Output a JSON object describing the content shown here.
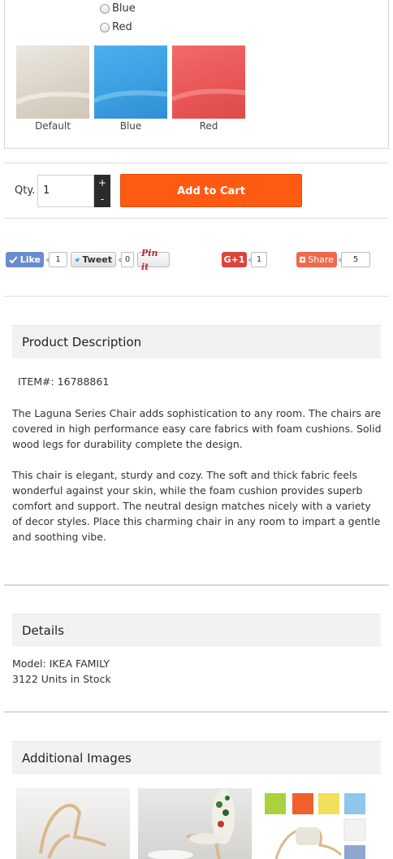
{
  "color_options": {
    "radios": [
      {
        "label": "Blue"
      },
      {
        "label": "Red"
      }
    ],
    "swatches": [
      {
        "label": "Default",
        "color": "#e3ddd3"
      },
      {
        "label": "Blue",
        "color": "#3aa0e0"
      },
      {
        "label": "Red",
        "color": "#ea5555"
      }
    ]
  },
  "cart": {
    "qty_label": "Qty.",
    "qty_value": "1",
    "plus": "+",
    "minus": "-",
    "add_label": "Add to Cart",
    "add_color": "#ff5a12"
  },
  "social": {
    "like": {
      "label": "Like",
      "count": "1",
      "icon": "check-icon",
      "color": "#6a8bd0"
    },
    "tweet": {
      "label": "Tweet",
      "count": "0",
      "icon": "twitter-bird-icon"
    },
    "pin": {
      "label": "Pin it",
      "icon": "pinterest-icon"
    },
    "gplus": {
      "label": "G+1",
      "count": "1",
      "color": "#d9453b"
    },
    "share": {
      "label": "Share",
      "count": "5",
      "icon": "plus-square-icon",
      "color": "#f0694e"
    }
  },
  "description": {
    "title": "Product Description",
    "item_number": "ITEM#: 16788861",
    "paragraph_1": "The Laguna Series Chair adds sophistication to any room. The chairs are covered in high performance easy care fabrics with foam cushions. Solid wood legs for durability complete the design.",
    "paragraph_2": "This chair is elegant, sturdy and cozy. The soft and thick fabric feels wonderful against your skin, while the foam cushion provides superb comfort and support. The neutral design matches nicely with a variety of decor styles. Place this charming chair in any room to impart a gentle and soothing vibe."
  },
  "details": {
    "title": "Details",
    "model": "Model: IKEA FAMILY",
    "stock": "3122 Units in Stock"
  },
  "additional": {
    "title": "Additional Images"
  }
}
